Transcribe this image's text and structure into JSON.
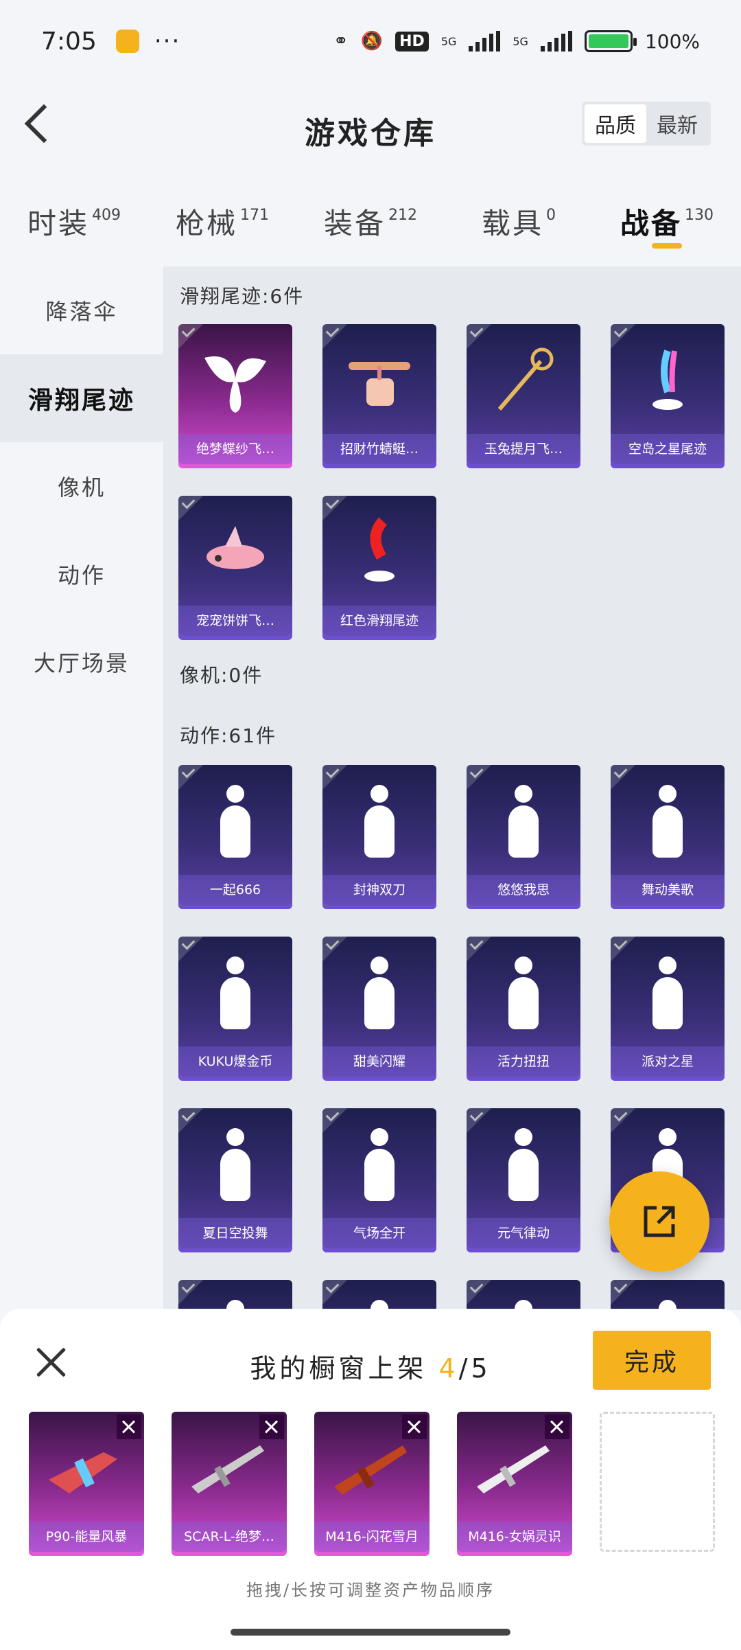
{
  "status_bar": {
    "time": "7:05",
    "dots": "···",
    "signal_label_1": "5G",
    "signal_label_2": "5G",
    "hd": "HD",
    "battery": "100%"
  },
  "header": {
    "title": "游戏仓库",
    "sort_options": [
      "品质",
      "最新"
    ],
    "sort_selected": "品质"
  },
  "category_tabs": [
    {
      "label": "时装",
      "count": "409"
    },
    {
      "label": "枪械",
      "count": "171"
    },
    {
      "label": "装备",
      "count": "212"
    },
    {
      "label": "载具",
      "count": "0"
    },
    {
      "label": "战备",
      "count": "130"
    }
  ],
  "active_category": "战备",
  "sidebar": {
    "items": [
      "降落伞",
      "滑翔尾迹",
      "像机",
      "动作",
      "大厅场景"
    ],
    "active": "滑翔尾迹"
  },
  "sections": {
    "trails": {
      "title": "滑翔尾迹:6件",
      "items": [
        "绝梦蝶纱飞…",
        "招财竹蜻蜓…",
        "玉兔提月飞…",
        "空岛之星尾迹",
        "宠宠饼饼飞…",
        "红色滑翔尾迹"
      ]
    },
    "camera": {
      "title": "像机:0件"
    },
    "actions": {
      "title": "动作:61件",
      "items": [
        "一起666",
        "封神双刀",
        "悠悠我思",
        "舞动美歌",
        "KUKU爆金币",
        "甜美闪耀",
        "活力扭扭",
        "派对之星",
        "夏日空投舞",
        "气场全开",
        "元气律动",
        ""
      ]
    }
  },
  "bottom_sheet": {
    "title_prefix": "我的橱窗上架 ",
    "current": "4",
    "title_suffix": "/5",
    "done_label": "完成",
    "shelf_items": [
      "P90-能量风暴",
      "SCAR-L-绝梦…",
      "M416-闪花雪月",
      "M416-女娲灵识"
    ],
    "hint": "拖拽/长按可调整资产物品顺序"
  },
  "colors": {
    "accent": "#f6b21c",
    "card_purple": "#3a2f78",
    "card_pink": "#8a2a8e"
  }
}
